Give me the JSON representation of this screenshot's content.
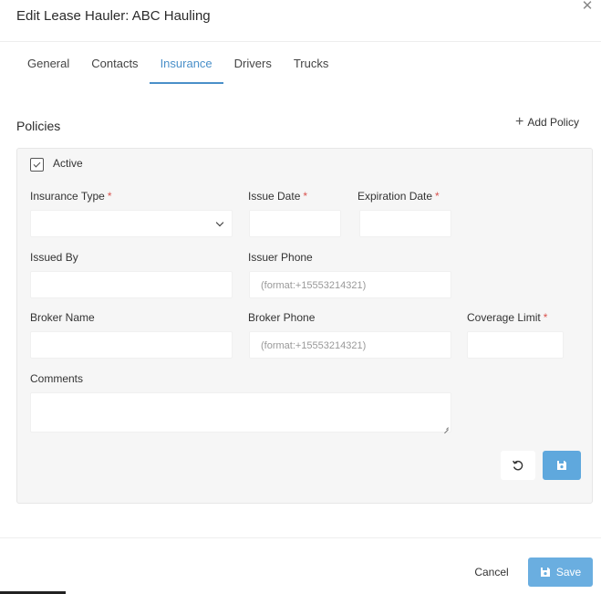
{
  "dialog": {
    "title": "Edit Lease Hauler: ABC Hauling",
    "close_icon": "close-icon"
  },
  "tabs": [
    {
      "label": "General",
      "active": false
    },
    {
      "label": "Contacts",
      "active": false
    },
    {
      "label": "Insurance",
      "active": true
    },
    {
      "label": "Drivers",
      "active": false
    },
    {
      "label": "Trucks",
      "active": false
    }
  ],
  "policies": {
    "heading": "Policies",
    "add_label": "Add Policy",
    "active_label": "Active",
    "active_checked": true,
    "fields": {
      "insurance_type": {
        "label": "Insurance Type",
        "required": "*",
        "value": ""
      },
      "issue_date": {
        "label": "Issue Date",
        "required": "*",
        "value": ""
      },
      "expiration_date": {
        "label": "Expiration Date",
        "required": "*",
        "value": ""
      },
      "issued_by": {
        "label": "Issued By",
        "value": ""
      },
      "issuer_phone": {
        "label": "Issuer Phone",
        "placeholder": "(format:+15553214321)"
      },
      "broker_name": {
        "label": "Broker Name",
        "value": ""
      },
      "broker_phone": {
        "label": "Broker Phone",
        "placeholder": "(format:+15553214321)"
      },
      "coverage_limit": {
        "label": "Coverage Limit",
        "required": "*",
        "value": ""
      },
      "comments": {
        "label": "Comments",
        "value": ""
      }
    }
  },
  "footer": {
    "cancel_label": "Cancel",
    "save_label": "Save"
  },
  "colors": {
    "accent": "#4a90c9",
    "save_button": "#6aaee0",
    "required": "#d9534f"
  }
}
